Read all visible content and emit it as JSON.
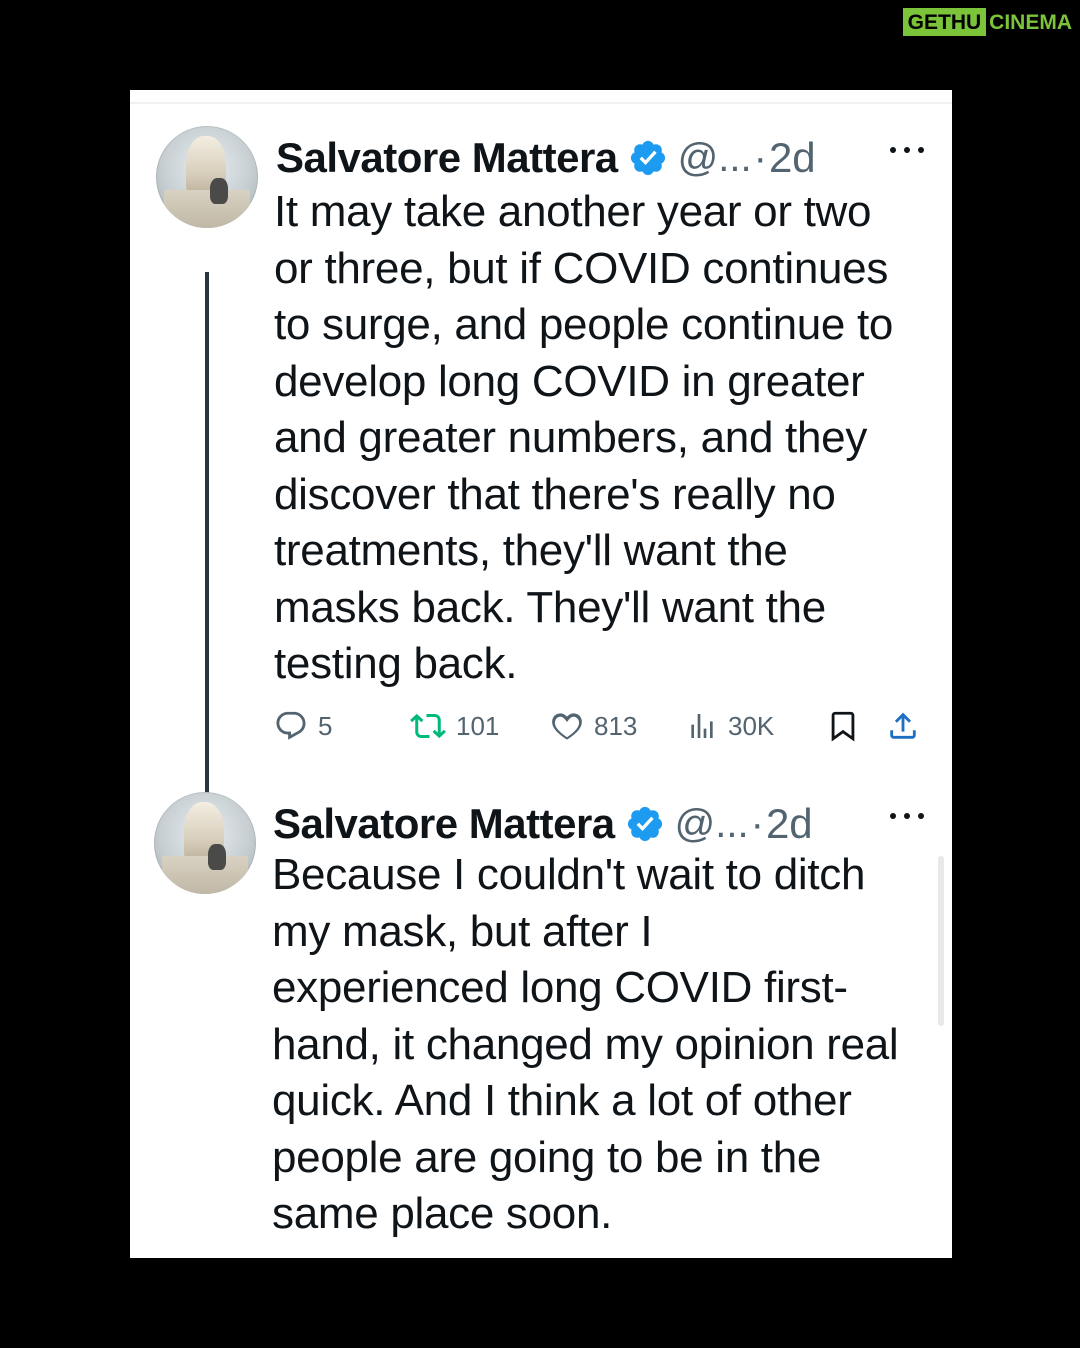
{
  "watermark": {
    "part1": "GETHU",
    "part2": "CINEMA"
  },
  "thread": [
    {
      "author": "Salvatore Mattera",
      "handle": "@...",
      "separator": "·",
      "time": "2d",
      "verified": true,
      "text": "It may take another year or two\nor three, but if COVID continues\nto surge, and people continue to\ndevelop long COVID in greater\nand greater numbers, and they\ndiscover that there's really no\ntreatments, they'll want the\nmasks back. They'll want the\ntesting back.",
      "metrics": {
        "replies": "5",
        "reposts": "101",
        "likes": "813",
        "views": "30K"
      }
    },
    {
      "author": "Salvatore Mattera",
      "handle": "@...",
      "separator": "·",
      "time": "2d",
      "verified": true,
      "text": "Because I couldn't wait to ditch\nmy mask, but after I\nexperienced long COVID first-\nhand, it changed my opinion real\nquick. And I think a lot of other\npeople are  going to be in the\nsame place soon."
    }
  ],
  "icons": {
    "verified": "verified-badge-icon",
    "more": "more-icon",
    "reply": "reply-icon",
    "repost": "repost-icon",
    "like": "like-icon",
    "views": "views-icon",
    "bookmark": "bookmark-icon",
    "share": "share-icon"
  },
  "colors": {
    "verified_blue": "#1d9bf0",
    "repost_green": "#00ba7c",
    "text_primary": "#0f1419",
    "text_secondary": "#536471",
    "watermark_green": "#7bc43a"
  }
}
